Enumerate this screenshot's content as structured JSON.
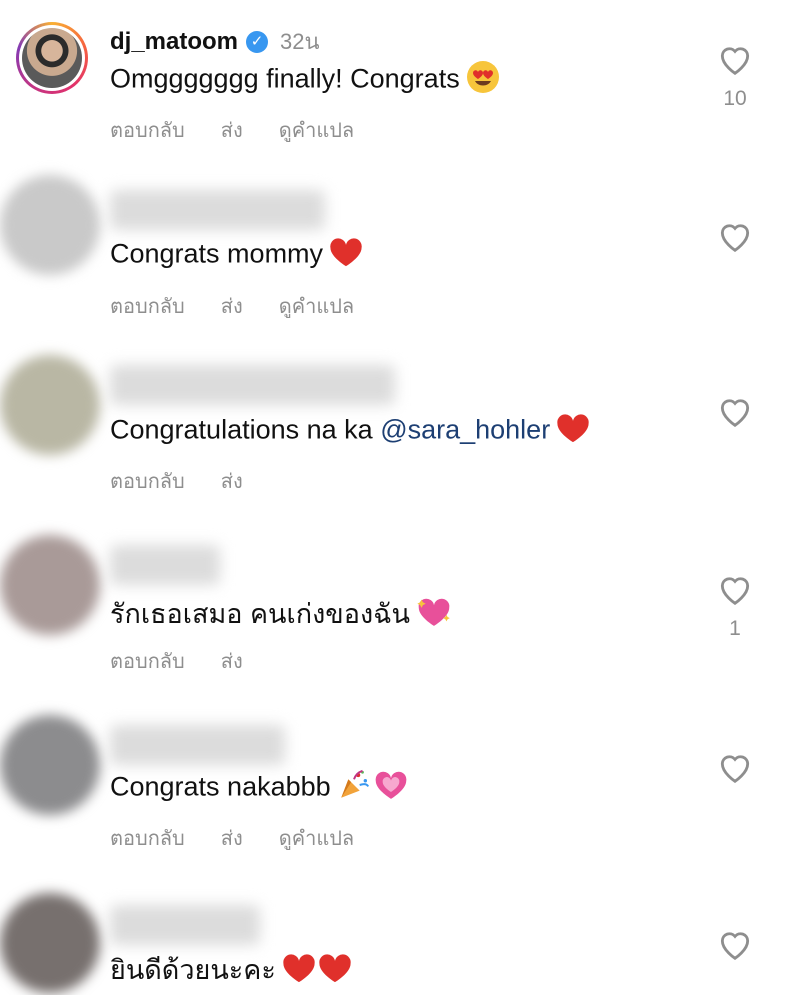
{
  "comments": [
    {
      "username": "dj_matoom",
      "verified": true,
      "time": "32น",
      "text": "Omggggggg finally! Congrats",
      "emoji": [
        "heart-eyes"
      ],
      "actions": [
        "ตอบกลับ",
        "ส่ง",
        "ดูคำแปล"
      ],
      "likes": "10"
    },
    {
      "text": "Congrats mommy",
      "emoji": [
        "red-heart"
      ],
      "actions": [
        "ตอบกลับ",
        "ส่ง",
        "ดูคำแปล"
      ],
      "likes": ""
    },
    {
      "text": "Congratulations na ka",
      "mention": "@sara_hohler",
      "emoji": [
        "red-heart"
      ],
      "actions": [
        "ตอบกลับ",
        "ส่ง"
      ],
      "likes": ""
    },
    {
      "text": "รักเธอเสมอ คนเก่งของฉัน",
      "emoji": [
        "sparkling-heart"
      ],
      "actions": [
        "ตอบกลับ",
        "ส่ง"
      ],
      "likes": "1"
    },
    {
      "text": "Congrats nakabbb",
      "emoji": [
        "party-popper",
        "sparkling-heart"
      ],
      "actions": [
        "ตอบกลับ",
        "ส่ง",
        "ดูคำแปล"
      ],
      "likes": ""
    },
    {
      "text": "ยินดีด้วยนะคะ",
      "emoji": [
        "red-heart",
        "red-heart"
      ],
      "actions": [],
      "likes": ""
    }
  ],
  "colors": {
    "muted": "#8e8e8e",
    "mention": "#1d3f73",
    "verified": "#3897f0",
    "heart": "#e0302b"
  }
}
